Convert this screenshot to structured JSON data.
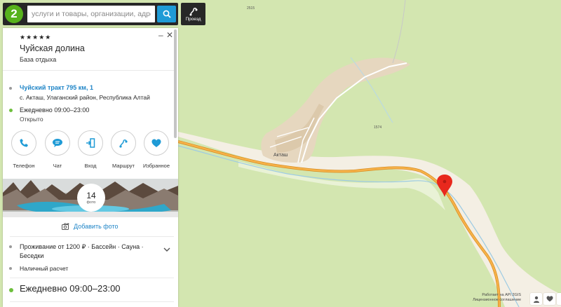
{
  "search": {
    "placeholder": "услуги и товары, организации, адреса"
  },
  "route": {
    "label": "Проезд"
  },
  "map": {
    "village_label": "Акташ",
    "elevation_labels": [
      "2515",
      "1574"
    ],
    "footer_line1": "Работает на API 2GIS",
    "footer_line2": "Лицензионное соглашение"
  },
  "card": {
    "rating_stars": "★★★★★",
    "title": "Чуйская долина",
    "subtitle": "База отдыха",
    "address_link": "Чуйский тракт 795 км, 1",
    "address_detail": "с. Акташ, Улаганский район, Республика Алтай",
    "schedule": "Ежедневно 09:00–23:00",
    "status": "Открыто",
    "actions": [
      {
        "label": "Телефон",
        "icon": "phone-icon"
      },
      {
        "label": "Чат",
        "icon": "chat-icon"
      },
      {
        "label": "Вход",
        "icon": "entrance-icon"
      },
      {
        "label": "Маршрут",
        "icon": "route-icon"
      },
      {
        "label": "Избранное",
        "icon": "heart-icon"
      }
    ],
    "photo_count": "14",
    "photo_word": "фото",
    "add_photo": "Добавить фото",
    "features": "Проживание от 1200 ₽ · Бассейн · Сауна · Беседки",
    "payment": "Наличный расчет",
    "schedule_large": "Ежедневно 09:00–23:00"
  },
  "colors": {
    "accent": "#1f9bd6",
    "link": "#1f85c7",
    "brand": "#57b21c",
    "pin": "#e8281d",
    "road": "#f2a53a",
    "forest": "#d3e6b0",
    "meadow": "#f4efe4"
  }
}
